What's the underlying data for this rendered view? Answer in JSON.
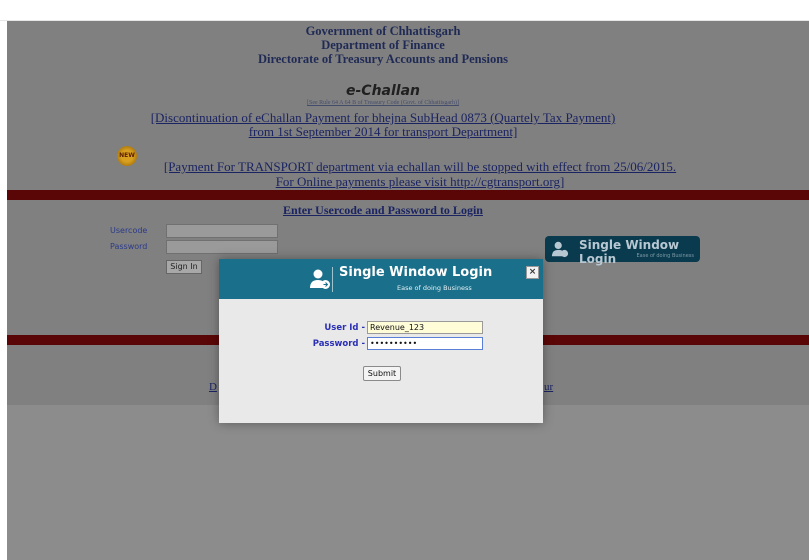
{
  "header": {
    "gov_line1": "Government of Chhattisgarh",
    "gov_line2": "Department of Finance",
    "gov_line3": "Directorate of Treasury Accounts and Pensions",
    "app_title": "e-Challan",
    "rule_text": "[See Rule 64 A 64 B of Treasury Code (Govt. of Chhattisgarh)]",
    "notice1_line1": "[Discontinuation of eChallan Payment for bhejna SubHead 0873 (Quartely Tax Payment)",
    "notice1_line2": "from 1st September 2014 for transport Department]",
    "new_badge": "NEW",
    "notice2_line1": "[Payment For TRANSPORT department via echallan will be stopped with effect from 25/06/2015.",
    "notice2_line2": "For Online payments please visit http://cgtransport.org]"
  },
  "login": {
    "heading": "Enter Usercode and Password to Login",
    "usercode_label": "Usercode",
    "password_label": "Password",
    "signin_label": "Sign In",
    "bg_link_left": "D",
    "bg_link_right": "ur"
  },
  "single_window_bg": {
    "title": "Single Window Login",
    "subtitle": "Ease of doing Business"
  },
  "modal": {
    "title": "Single Window Login",
    "subtitle": "Ease of doing Business",
    "close_label": "×",
    "userid_label": "User Id -",
    "userid_value": "Revenue_123",
    "password_label": "Password -",
    "password_value": "••••••••••",
    "submit_label": "Submit"
  },
  "colors": {
    "header_blue": "#1a6f8a",
    "notice_text": "#1b2462",
    "band_red": "#5b0606"
  }
}
